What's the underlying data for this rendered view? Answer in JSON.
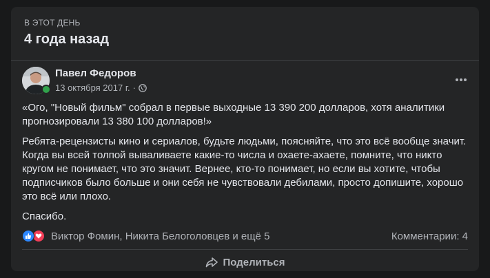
{
  "memory": {
    "label": "В ЭТОТ ДЕНЬ",
    "title": "4 года назад"
  },
  "post": {
    "author": "Павел Федоров",
    "date": "13 октября 2017 г.",
    "separator": "·",
    "privacy_icon": "globe-icon",
    "paragraphs": [
      "«Ого, \"Новый фильм\" собрал в первые выходные 13 390 200 долларов, хотя аналитики прогнозировали 13 380 100 долларов!»",
      "Ребята-рецензисты кино и сериалов, будьте людьми, поясняйте, что это всё вообще значит. Когда вы всей толпой вываливаете какие-то числа и охаете-ахаете, помните, что никто кругом не понимает, что это значит. Вернее, кто-то понимает, но если вы хотите, чтобы подписчиков было больше и они себя не чувствовали дебилами, просто допишите, хорошо это всё или плохо.",
      "Спасибо."
    ]
  },
  "reactions": {
    "icons": [
      "like-icon",
      "love-icon"
    ],
    "names": "Виктор Фомин, Никита Белоголовцев и ещё 5",
    "comments": "Комментарии: 4"
  },
  "actions": {
    "share_label": "Поделиться"
  },
  "colors": {
    "background": "#18191a",
    "card": "#242526",
    "text_primary": "#e4e6eb",
    "text_secondary": "#b0b3b8",
    "like": "#2d88ff",
    "love": "#f33e58",
    "online": "#31a24c"
  }
}
